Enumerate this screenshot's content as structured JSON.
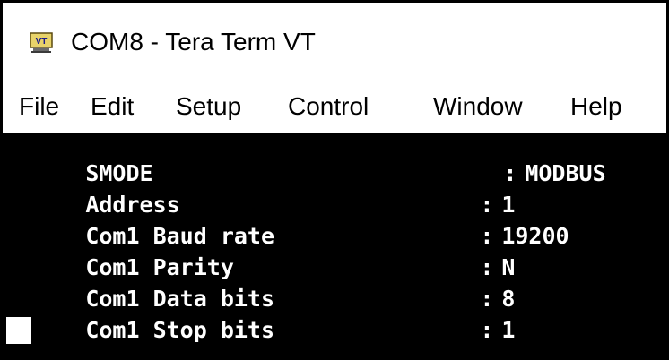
{
  "window": {
    "title": "COM8 - Tera Term VT",
    "icon": "tera-term-vt-icon",
    "icon_text": "VT"
  },
  "menu": {
    "items": [
      {
        "label": "File"
      },
      {
        "label": "Edit"
      },
      {
        "label": "Setup"
      },
      {
        "label": "Control"
      },
      {
        "label": "Window"
      },
      {
        "label": "Help"
      }
    ]
  },
  "terminal": {
    "lines": [
      {
        "label": "SMODE",
        "sep": ":",
        "value": "MODBUS"
      },
      {
        "label": "Address",
        "sep": ":",
        "value": "1"
      },
      {
        "label": "Com1 Baud rate",
        "sep": ":",
        "value": "19200"
      },
      {
        "label": "Com1 Parity",
        "sep": ":",
        "value": "N"
      },
      {
        "label": "Com1 Data bits",
        "sep": ":",
        "value": "8"
      },
      {
        "label": "Com1 Stop bits",
        "sep": ":",
        "value": "1"
      }
    ]
  },
  "colors": {
    "terminal_bg": "#000000",
    "terminal_fg": "#ffffff",
    "icon_bg": "#e8d36a"
  }
}
